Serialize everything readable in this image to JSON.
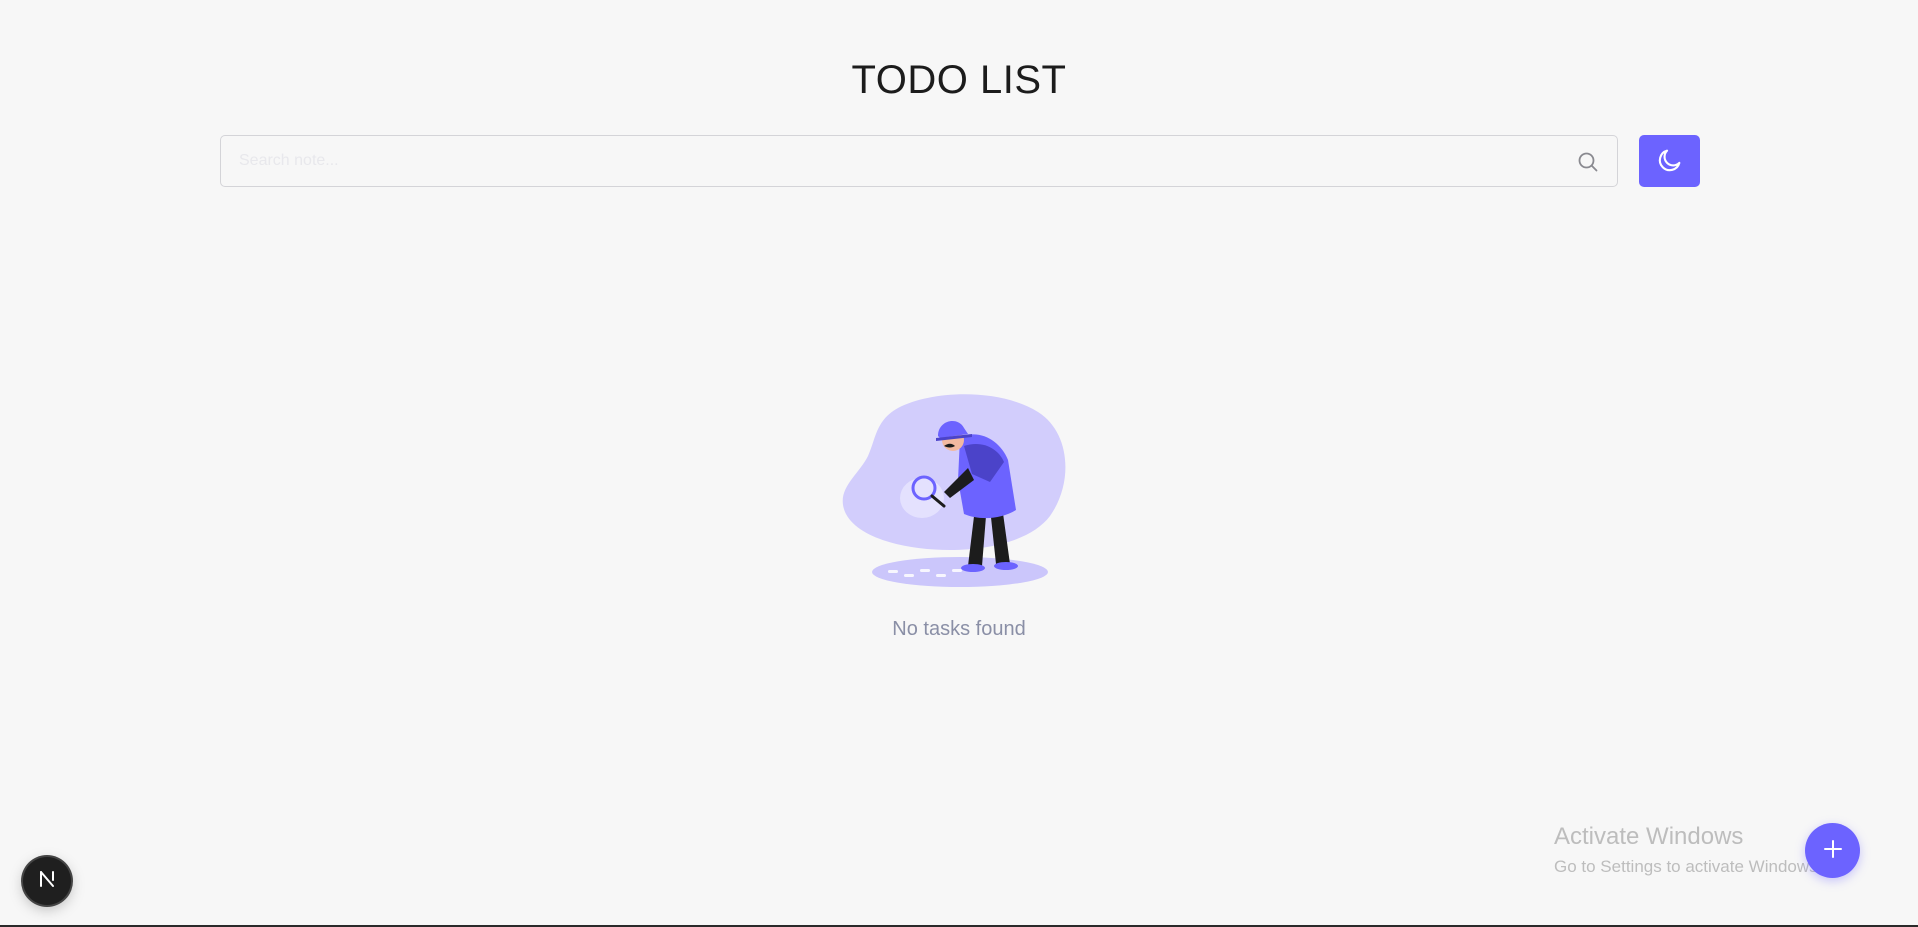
{
  "header": {
    "title": "TODO LIST"
  },
  "search": {
    "value": "",
    "placeholder": "Search note...",
    "icon": "search-icon"
  },
  "theme_toggle": {
    "icon": "moon-icon"
  },
  "empty_state": {
    "message": "No tasks found",
    "illustration": "detective-searching-illustration"
  },
  "fab": {
    "icon": "plus-icon"
  },
  "dev_badge": {
    "label": "N"
  },
  "watermark": {
    "title": "Activate Windows",
    "subtitle": "Go to Settings to activate Windows."
  },
  "colors": {
    "accent": "#6c63ff",
    "background": "#f7f7f7",
    "muted_text": "#8a8fa6"
  }
}
